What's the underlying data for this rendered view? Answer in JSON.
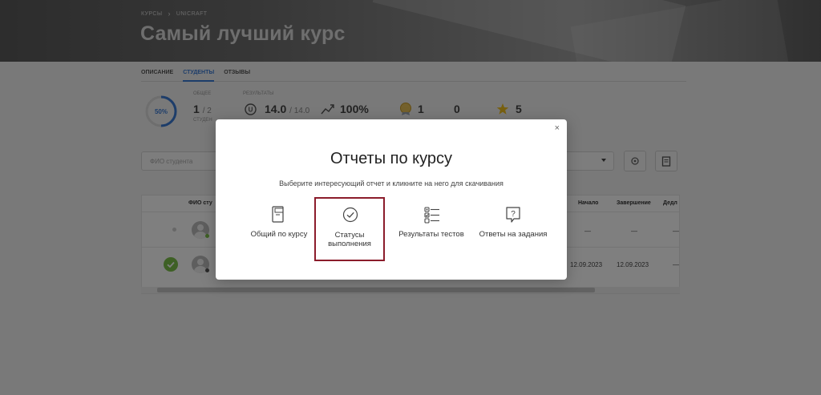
{
  "breadcrumb": [
    "КУРСЫ",
    "UNICRAFT"
  ],
  "page_title": "Самый лучший курс",
  "tabs": [
    {
      "label": "ОПИСАНИЕ",
      "active": false
    },
    {
      "label": "СТУДЕНТЫ",
      "active": true
    },
    {
      "label": "ОТЗЫВЫ",
      "active": false
    }
  ],
  "stats": {
    "progress_percent": 50,
    "progress_label": "50%",
    "overall_label": "ОБЩЕЕ",
    "students_value": "1",
    "students_total": "/ 2",
    "students_label": "СТУДЕН",
    "results_label": "РЕЗУЛЬТАТЫ",
    "score_value": "14.0",
    "score_total": "/ 14.0",
    "percent_value": "100%",
    "medal_count": "1",
    "zero_count": "0",
    "star_count": "5"
  },
  "filter": {
    "placeholder": "ФИО студента"
  },
  "table": {
    "columns": {
      "name": "ФИО сту",
      "start": "Начало",
      "end": "Завершение",
      "deadline": "Дедл"
    },
    "rows": [
      {
        "start": "—",
        "end": "—",
        "deadline": "—"
      },
      {
        "start": "12.09.2023",
        "end": "12.09.2023",
        "deadline": "—"
      }
    ]
  },
  "modal": {
    "title": "Отчеты по курсу",
    "subtitle": "Выберите интересующий отчет и кликните на него для скачивания",
    "close": "×",
    "options": [
      {
        "label": "Общий по курсу",
        "icon": "document-report-icon",
        "selected": false
      },
      {
        "label": "Статусы выполнения",
        "icon": "check-circle-icon",
        "selected": true
      },
      {
        "label": "Результаты тестов",
        "icon": "checklist-icon",
        "selected": false
      },
      {
        "label": "Ответы на задания",
        "icon": "question-bubble-icon",
        "selected": false
      }
    ]
  },
  "colors": {
    "accent": "#3b7bd4",
    "selection": "#8b1c2b",
    "success": "#7cc04b",
    "star": "#f0c020"
  }
}
